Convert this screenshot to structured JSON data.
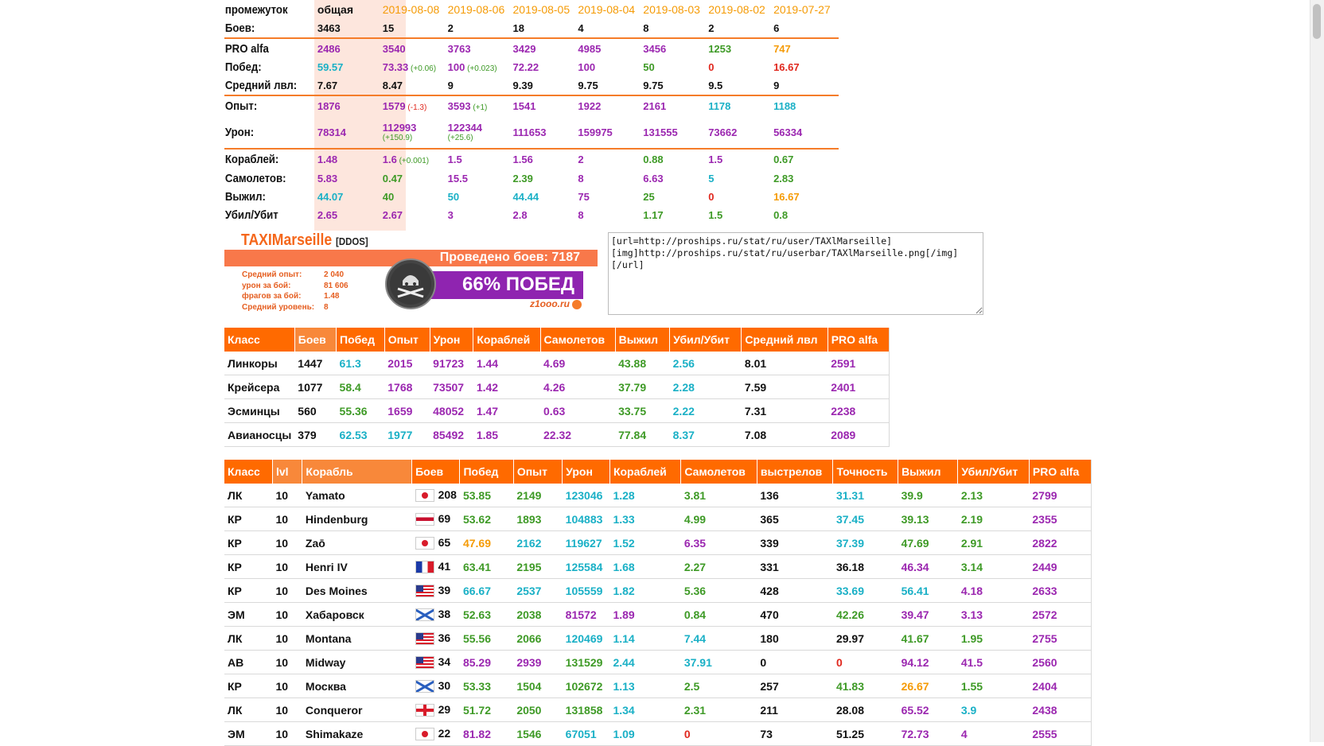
{
  "summary": {
    "header": {
      "label": "промежуток",
      "cols": [
        "общая",
        "2019-08-08",
        "2019-08-06",
        "2019-08-05",
        "2019-08-04",
        "2019-08-03",
        "2019-08-02",
        "2019-07-27"
      ]
    },
    "battles": {
      "label": "Боев:",
      "values": [
        "3463",
        "15",
        "2",
        "18",
        "4",
        "8",
        "2",
        "6"
      ]
    },
    "pro": {
      "label": "PRO alfa",
      "values": [
        "2486",
        "3540",
        "3763",
        "3429",
        "4985",
        "3456",
        "1253",
        "747"
      ]
    },
    "wins": {
      "label": "Побед:",
      "values": [
        "59.57",
        "73.33",
        "100",
        "72.22",
        "100",
        "50",
        "0",
        "16.67"
      ],
      "deltas": [
        "",
        "(+0.06)",
        "(+0.023)",
        "",
        "",
        "",
        "",
        ""
      ]
    },
    "avglvl": {
      "label": "Средний лвл:",
      "values": [
        "7.67",
        "8.47",
        "9",
        "9.39",
        "9.75",
        "9.75",
        "9.5",
        "9"
      ]
    },
    "exp": {
      "label": "Опыт:",
      "values": [
        "1876",
        "1579",
        "3593",
        "1541",
        "1922",
        "2161",
        "1178",
        "1188"
      ],
      "deltas": [
        "",
        "(-1.3)",
        "(+1)",
        "",
        "",
        "",
        "",
        ""
      ]
    },
    "damage": {
      "label": "Урон:",
      "values": [
        "78314",
        "112993",
        "122344",
        "111653",
        "159975",
        "131555",
        "73662",
        "56334"
      ],
      "deltas": [
        "",
        "(+150.9)",
        "(+25.6)",
        "",
        "",
        "",
        "",
        ""
      ]
    },
    "ships": {
      "label": "Кораблей:",
      "values": [
        "1.48",
        "1.6",
        "1.5",
        "1.56",
        "2",
        "0.88",
        "1.5",
        "0.67"
      ],
      "deltas": [
        "",
        "(+0.001)",
        "",
        "",
        "",
        "",
        "",
        ""
      ]
    },
    "planes": {
      "label": "Самолетов:",
      "values": [
        "5.83",
        "0.47",
        "15.5",
        "2.39",
        "8",
        "6.63",
        "5",
        "2.83"
      ]
    },
    "survived": {
      "label": "Выжил:",
      "values": [
        "44.07",
        "40",
        "50",
        "44.44",
        "75",
        "25",
        "0",
        "16.67"
      ]
    },
    "kd": {
      "label": "Убил/Убит",
      "values": [
        "2.65",
        "2.67",
        "3",
        "2.8",
        "8",
        "1.17",
        "1.5",
        "0.8"
      ]
    }
  },
  "userbar": {
    "nick": "TAXIMarseille",
    "clan": "[DDOS]",
    "battles": "Проведено боев: 7187",
    "winrate": "66% ПОБЕД",
    "site": "z1ooo.ru",
    "stats": [
      {
        "k": "Средний опыт:",
        "v": "2 040"
      },
      {
        "k": "урон за бой:",
        "v": "81 606"
      },
      {
        "k": "фрагов за бой:",
        "v": "1.48"
      },
      {
        "k": "Средний уровень:",
        "v": "8"
      }
    ]
  },
  "bbcode": "[url=http://proships.ru/stat/ru/user/TAXlMarseille]\n[img]http://proships.ru/stat/ru/userbar/TAXlMarseille.png[/img]\n[/url]",
  "classes": {
    "headers": [
      "Класс",
      "Боев",
      "Побед",
      "Опыт",
      "Урон",
      "Кораблей",
      "Самолетов",
      "Выжил",
      "Убил/Убит",
      "Средний лвл",
      "PRO alfa"
    ],
    "rows": [
      [
        "Линкоры",
        "1447",
        "61.3",
        "2015",
        "91723",
        "1.44",
        "4.69",
        "43.88",
        "2.56",
        "8.01",
        "2591"
      ],
      [
        "Крейсера",
        "1077",
        "58.4",
        "1768",
        "73507",
        "1.42",
        "4.26",
        "37.79",
        "2.28",
        "7.59",
        "2401"
      ],
      [
        "Эсминцы",
        "560",
        "55.36",
        "1659",
        "48052",
        "1.47",
        "0.63",
        "33.75",
        "2.22",
        "7.31",
        "2238"
      ],
      [
        "Авианосцы",
        "379",
        "62.53",
        "1977",
        "85492",
        "1.85",
        "22.32",
        "77.84",
        "8.37",
        "7.08",
        "2089"
      ]
    ]
  },
  "ships_table": {
    "headers": [
      "Класс",
      "lvl",
      "Корабль",
      "Боев",
      "Побед",
      "Опыт",
      "Урон",
      "Кораблей",
      "Самолетов",
      "выстрелов",
      "Точность",
      "Выжил",
      "Убил/Убит",
      "PRO alfa"
    ],
    "rows": [
      {
        "cls": "ЛК",
        "lvl": "10",
        "name": "Yamato",
        "flag": "jp",
        "b": "208",
        "w": "53.85",
        "e": "2149",
        "d": "123046",
        "s": "1.28",
        "p": "3.81",
        "sh": "136",
        "acc": "31.31",
        "sv": "39.9",
        "kd": "2.13",
        "pro": "2799"
      },
      {
        "cls": "КР",
        "lvl": "10",
        "name": "Hindenburg",
        "flag": "de",
        "b": "69",
        "w": "53.62",
        "e": "1893",
        "d": "104883",
        "s": "1.33",
        "p": "4.99",
        "sh": "365",
        "acc": "37.45",
        "sv": "39.13",
        "kd": "2.19",
        "pro": "2355"
      },
      {
        "cls": "КР",
        "lvl": "10",
        "name": "Zaō",
        "flag": "jp",
        "b": "65",
        "w": "47.69",
        "e": "2162",
        "d": "119627",
        "s": "1.52",
        "p": "6.35",
        "sh": "339",
        "acc": "37.39",
        "sv": "47.69",
        "kd": "2.91",
        "pro": "2822"
      },
      {
        "cls": "КР",
        "lvl": "10",
        "name": "Henri IV",
        "flag": "fr",
        "b": "41",
        "w": "63.41",
        "e": "2195",
        "d": "125584",
        "s": "1.68",
        "p": "2.27",
        "sh": "331",
        "acc": "36.18",
        "sv": "46.34",
        "kd": "3.14",
        "pro": "2449"
      },
      {
        "cls": "КР",
        "lvl": "10",
        "name": "Des Moines",
        "flag": "us",
        "b": "39",
        "w": "66.67",
        "e": "2537",
        "d": "105559",
        "s": "1.82",
        "p": "5.36",
        "sh": "428",
        "acc": "33.69",
        "sv": "56.41",
        "kd": "4.18",
        "pro": "2633"
      },
      {
        "cls": "ЭМ",
        "lvl": "10",
        "name": "Хабаровск",
        "flag": "ru",
        "b": "38",
        "w": "52.63",
        "e": "2038",
        "d": "81572",
        "s": "1.89",
        "p": "0.84",
        "sh": "470",
        "acc": "42.26",
        "sv": "39.47",
        "kd": "3.13",
        "pro": "2572"
      },
      {
        "cls": "ЛК",
        "lvl": "10",
        "name": "Montana",
        "flag": "us",
        "b": "36",
        "w": "55.56",
        "e": "2066",
        "d": "120469",
        "s": "1.14",
        "p": "7.44",
        "sh": "180",
        "acc": "29.97",
        "sv": "41.67",
        "kd": "1.95",
        "pro": "2755"
      },
      {
        "cls": "АВ",
        "lvl": "10",
        "name": "Midway",
        "flag": "us",
        "b": "34",
        "w": "85.29",
        "e": "2939",
        "d": "131529",
        "s": "2.44",
        "p": "37.91",
        "sh": "0",
        "acc": "0",
        "sv": "94.12",
        "kd": "41.5",
        "pro": "2560"
      },
      {
        "cls": "КР",
        "lvl": "10",
        "name": "Москва",
        "flag": "ru",
        "b": "30",
        "w": "53.33",
        "e": "1504",
        "d": "102672",
        "s": "1.13",
        "p": "2.5",
        "sh": "257",
        "acc": "41.83",
        "sv": "26.67",
        "kd": "1.55",
        "pro": "2404"
      },
      {
        "cls": "ЛК",
        "lvl": "10",
        "name": "Conqueror",
        "flag": "uk",
        "b": "29",
        "w": "51.72",
        "e": "2050",
        "d": "131858",
        "s": "1.34",
        "p": "2.31",
        "sh": "211",
        "acc": "28.08",
        "sv": "65.52",
        "kd": "3.9",
        "pro": "2438"
      },
      {
        "cls": "ЭМ",
        "lvl": "10",
        "name": "Shimakaze",
        "flag": "jp",
        "b": "22",
        "w": "81.82",
        "e": "1546",
        "d": "67051",
        "s": "1.09",
        "p": "0",
        "sh": "73",
        "acc": "51.25",
        "sv": "72.73",
        "kd": "4",
        "pro": "2555"
      }
    ]
  },
  "colors": {
    "accent": "#ff6a00",
    "label_bg": "#fde6dd",
    "purple": "#9b27b0",
    "blue": "#1ab0c6",
    "green": "#3e9a26",
    "red": "#e0281e",
    "orange": "#f59b06"
  }
}
